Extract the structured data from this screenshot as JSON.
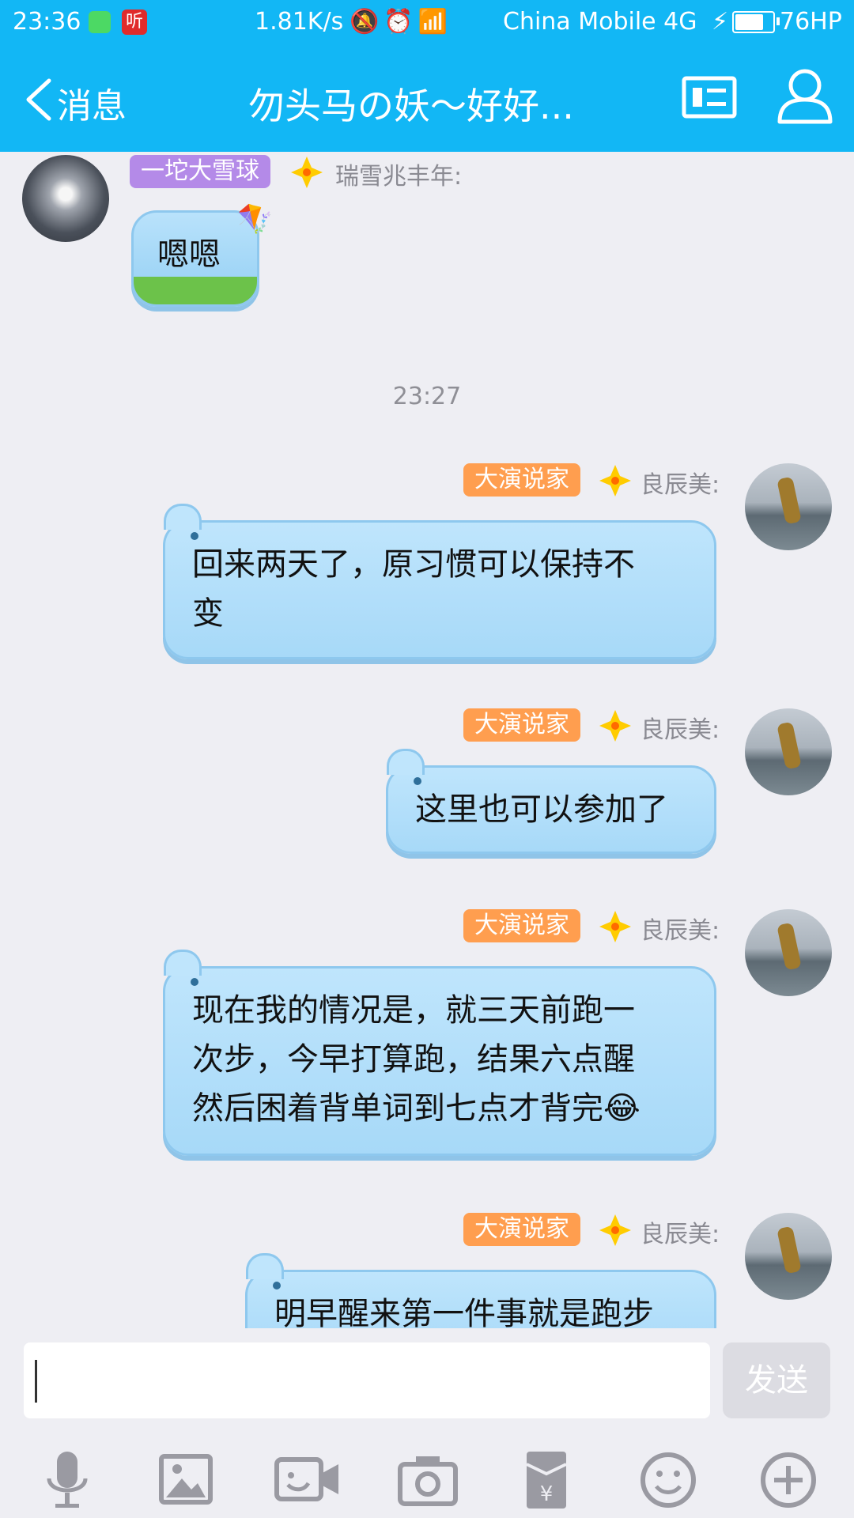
{
  "status_bar": {
    "time": "23:36",
    "app_b_label": "听",
    "speed": "1.81K/s",
    "carrier": "China Mobile 4G",
    "battery_text": "76HP",
    "battery_level": 0.76
  },
  "nav": {
    "back_label": "消息",
    "title": "勿头马の妖～好好..."
  },
  "messages": [
    {
      "tag": "一坨大雪球",
      "sender": "瑞雪兆丰年:",
      "text": "嗯嗯"
    },
    {
      "tag": "大演说家",
      "sender": "良辰美:",
      "lines": [
        "回来两天了，原习惯可以保持不",
        "变"
      ]
    },
    {
      "tag": "大演说家",
      "sender": "良辰美:",
      "text": "这里也可以参加了"
    },
    {
      "tag": "大演说家",
      "sender": "良辰美:",
      "lines": [
        "现在我的情况是，就三天前跑一",
        "次步，今早打算跑，结果六点醒",
        "然后困着背单词到七点才背完😂"
      ]
    },
    {
      "tag": "大演说家",
      "sender": "良辰美:",
      "text": "明早醒来第一件事就是跑步"
    }
  ],
  "timestamp": "23:27",
  "input": {
    "value": "",
    "send_label": "发送"
  },
  "toolbar": [
    "microphone-icon",
    "image-icon",
    "video-call-icon",
    "camera-icon",
    "red-packet-icon",
    "emoji-icon",
    "plus-icon"
  ],
  "colors": {
    "header": "#12b7f5",
    "bubble": "#a7d9f8",
    "tag_orange": "#ff9e4f",
    "tag_purple": "#b48ae8"
  }
}
